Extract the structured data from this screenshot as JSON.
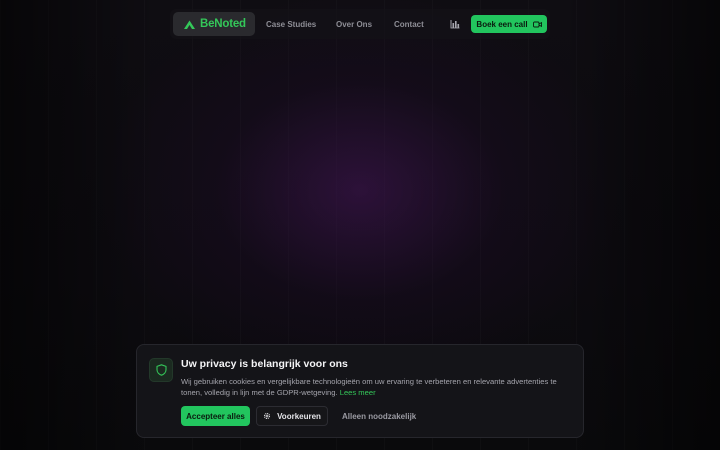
{
  "nav": {
    "logo_text": "BeNoted",
    "links": [
      {
        "label": "Case Studies"
      },
      {
        "label": "Over Ons"
      },
      {
        "label": "Contact"
      }
    ],
    "stats_icon": "bar-chart-icon",
    "cta_label": "Boek een call",
    "cta_icon": "video-camera-icon"
  },
  "cookie": {
    "title": "Uw privacy is belangrijk voor ons",
    "text": "Wij gebruiken cookies en vergelijkbare technologieën om uw ervaring te verbeteren en relevante advertenties te tonen, volledig in lijn met de GDPR-wetgeving.",
    "link_label": "Lees meer",
    "icon": "shield-icon",
    "accept_label": "Accepteer alles",
    "preferences_label": "Voorkeuren",
    "preferences_icon": "gear-icon",
    "necessary_label": "Alleen noodzakelijk"
  },
  "colors": {
    "accent": "#22c55e",
    "logo_green": "#34c759",
    "background": "#0b0a0d",
    "glow": "#46165a"
  }
}
